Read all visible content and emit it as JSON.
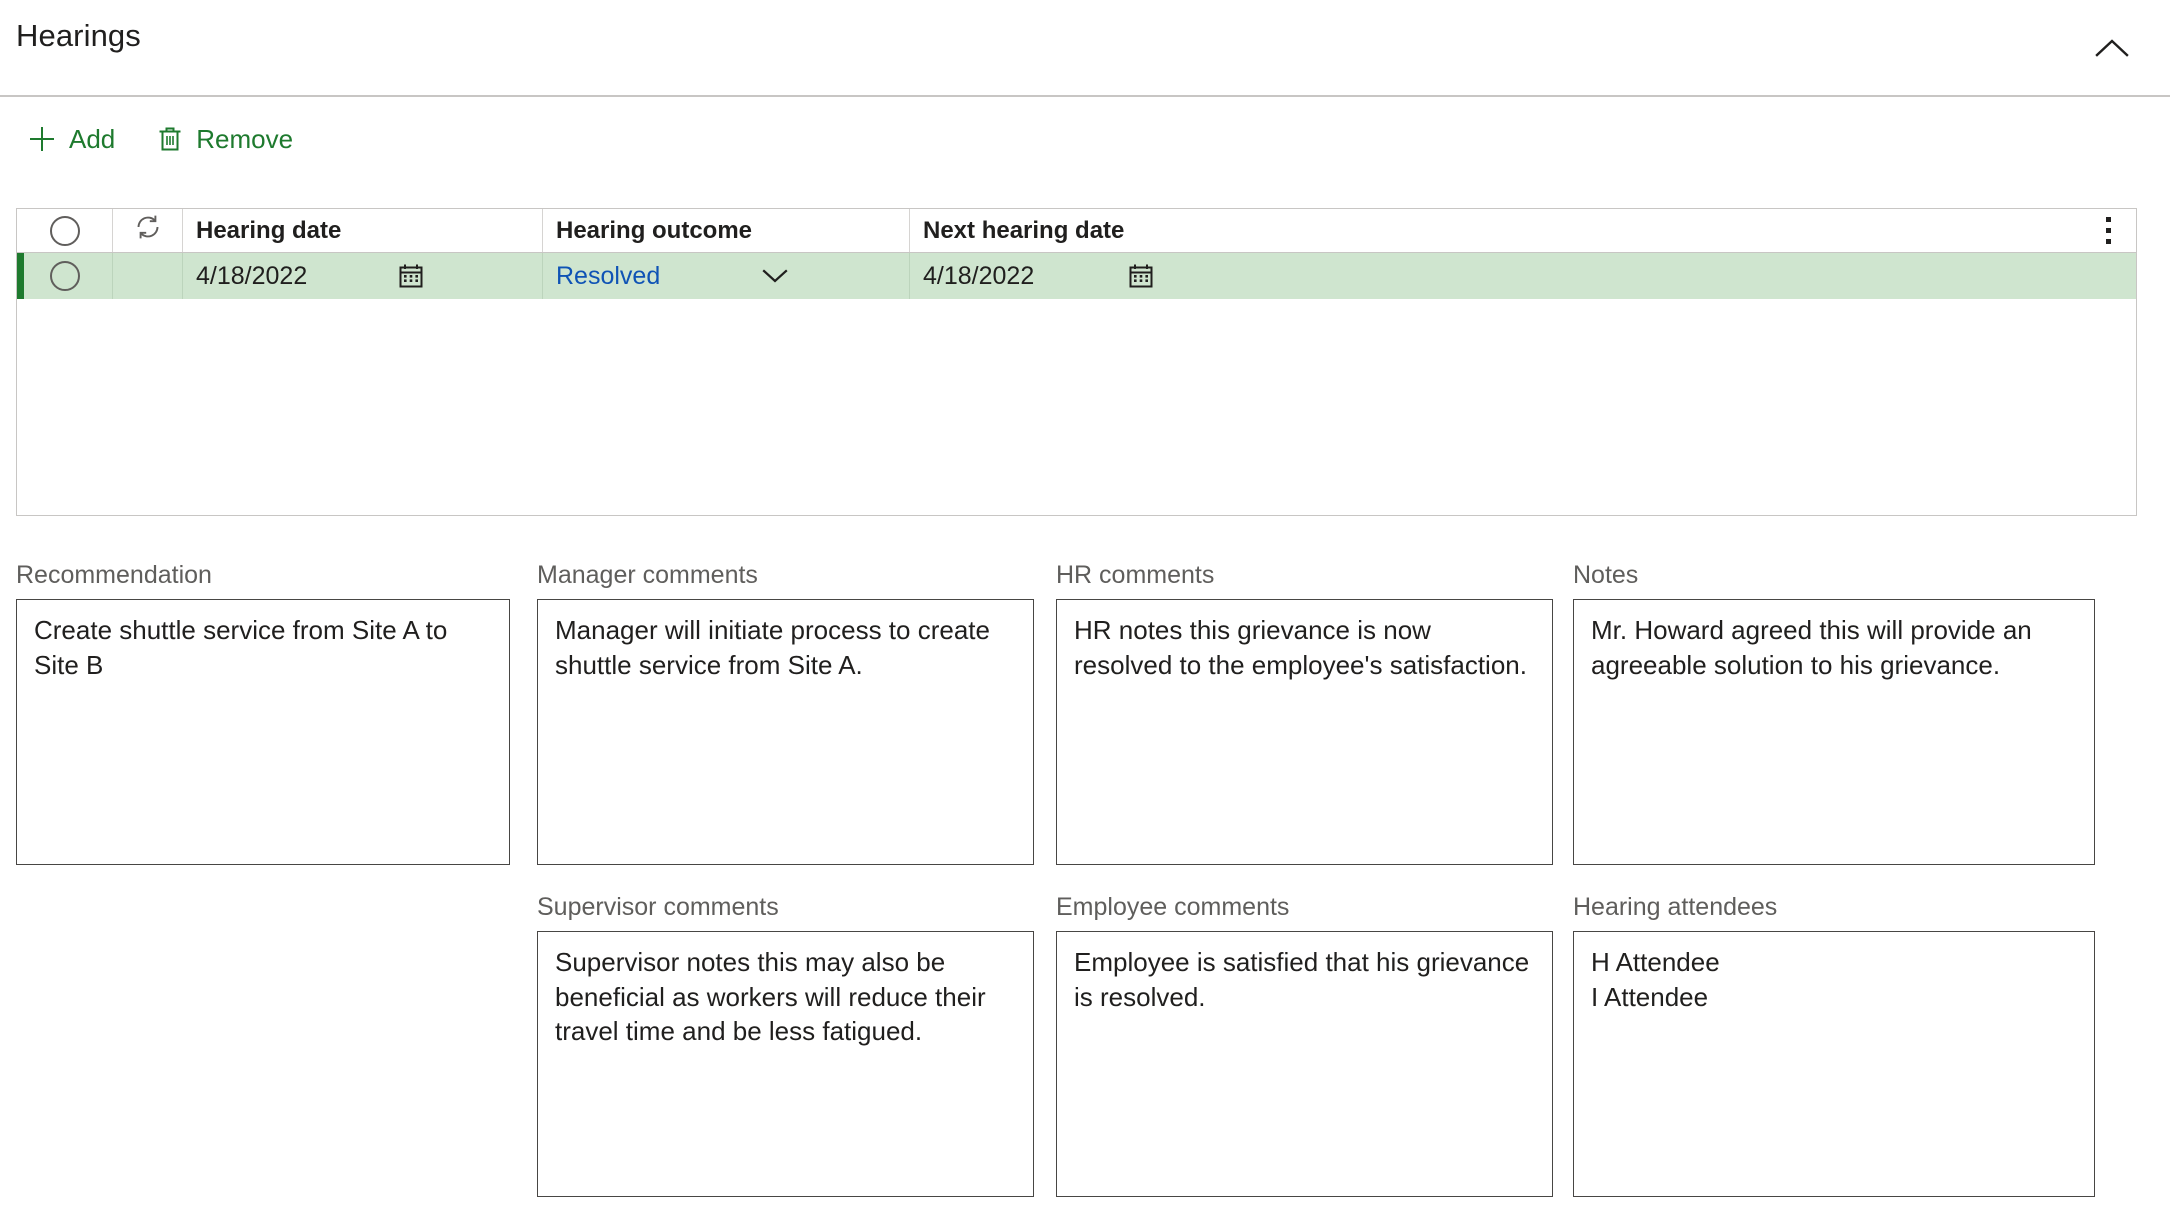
{
  "section": {
    "title": "Hearings",
    "collapse_icon": "chevron-up-icon"
  },
  "toolbar": {
    "buttons": [
      {
        "label": "Add",
        "icon": "plus-icon",
        "color": "#1e7a2e"
      },
      {
        "label": "Remove",
        "icon": "trash-icon",
        "color": "#1e7a2e"
      }
    ]
  },
  "grid": {
    "select_all_icon": "radio-circle-icon",
    "refresh_icon": "refresh-icon",
    "overflow_icon": "more-vertical-icon",
    "columns": [
      {
        "key": "select",
        "label": ""
      },
      {
        "key": "refresh",
        "label": ""
      },
      {
        "key": "hearing_date",
        "label": "Hearing date"
      },
      {
        "key": "hearing_outcome",
        "label": "Hearing outcome"
      },
      {
        "key": "next_hearing_date",
        "label": "Next hearing date"
      }
    ],
    "rows": [
      {
        "selected": true,
        "hearing_date": "4/18/2022",
        "hearing_date_icon": "calendar-icon",
        "hearing_outcome": "Resolved",
        "hearing_outcome_icon": "chevron-down-icon",
        "next_hearing_date": "4/18/2022",
        "next_hearing_date_icon": "calendar-icon"
      }
    ],
    "selected_row_bg": "#cfe5cf",
    "selected_row_accent": "#1e7a2e",
    "link_color": "#0f53b5"
  },
  "fields": {
    "recommendation": {
      "label": "Recommendation",
      "value": "Create shuttle service from Site A to Site B"
    },
    "manager_comments": {
      "label": "Manager comments",
      "value": "Manager will initiate process to create shuttle service from Site A."
    },
    "hr_comments": {
      "label": "HR comments",
      "value": "HR notes this grievance is now resolved to the employee's satisfaction."
    },
    "notes": {
      "label": "Notes",
      "value": "Mr. Howard agreed this will provide an agreeable solution to his grievance."
    },
    "supervisor_comments": {
      "label": "Supervisor comments",
      "value": "Supervisor notes this may also be beneficial as workers will reduce their travel time and be less fatigued."
    },
    "employee_comments": {
      "label": "Employee comments",
      "value": "Employee is satisfied that his grievance is resolved."
    },
    "hearing_attendees": {
      "label": "Hearing attendees",
      "value": "H Attendee\nI Attendee"
    }
  }
}
